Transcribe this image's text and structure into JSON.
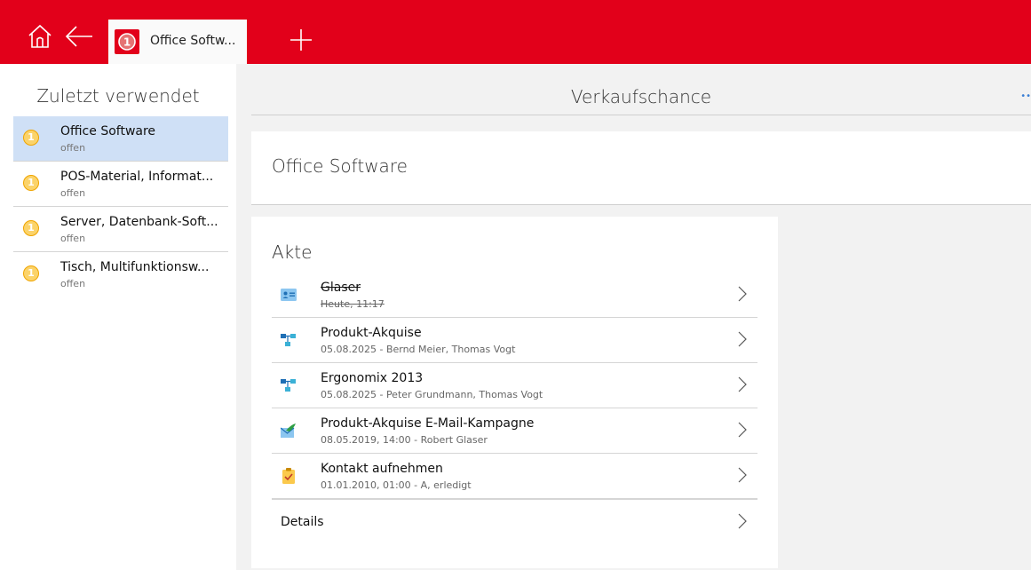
{
  "tab": {
    "label": "Office Softw...",
    "badge": "1"
  },
  "sidebar": {
    "title": "Zuletzt verwendet",
    "items": [
      {
        "badge": "1",
        "title": "Office Software",
        "status": "offen"
      },
      {
        "badge": "1",
        "title": "POS-Material, Informat...",
        "status": "offen"
      },
      {
        "badge": "1",
        "title": "Server, Datenbank-Soft...",
        "status": "offen"
      },
      {
        "badge": "1",
        "title": "Tisch, Multifunktionsw...",
        "status": "offen"
      }
    ]
  },
  "main": {
    "title": "Verkaufschance",
    "more": "••",
    "record_title": "Office Software"
  },
  "akte": {
    "title": "Akte",
    "items": [
      {
        "icon": "contact-card-icon",
        "title": "Glaser",
        "subtitle": "Heute, 11:17"
      },
      {
        "icon": "workflow-icon",
        "title": "Produkt-Akquise",
        "subtitle": "05.08.2025 - Bernd Meier, Thomas Vogt"
      },
      {
        "icon": "workflow-icon",
        "title": "Ergonomix 2013",
        "subtitle": "05.08.2025 - Peter Grundmann, Thomas Vogt"
      },
      {
        "icon": "email-campaign-icon",
        "title": "Produkt-Akquise E-Mail-Kampagne",
        "subtitle": "08.05.2019, 14:00 - Robert Glaser"
      },
      {
        "icon": "task-clipboard-icon",
        "title": "Kontakt aufnehmen",
        "subtitle": "01.01.2010, 01:00 - A, erledigt"
      }
    ],
    "details_label": "Details"
  },
  "colors": {
    "brand": "#e2001a",
    "selection": "#cfe0f6",
    "badge": "#fbd36a"
  }
}
